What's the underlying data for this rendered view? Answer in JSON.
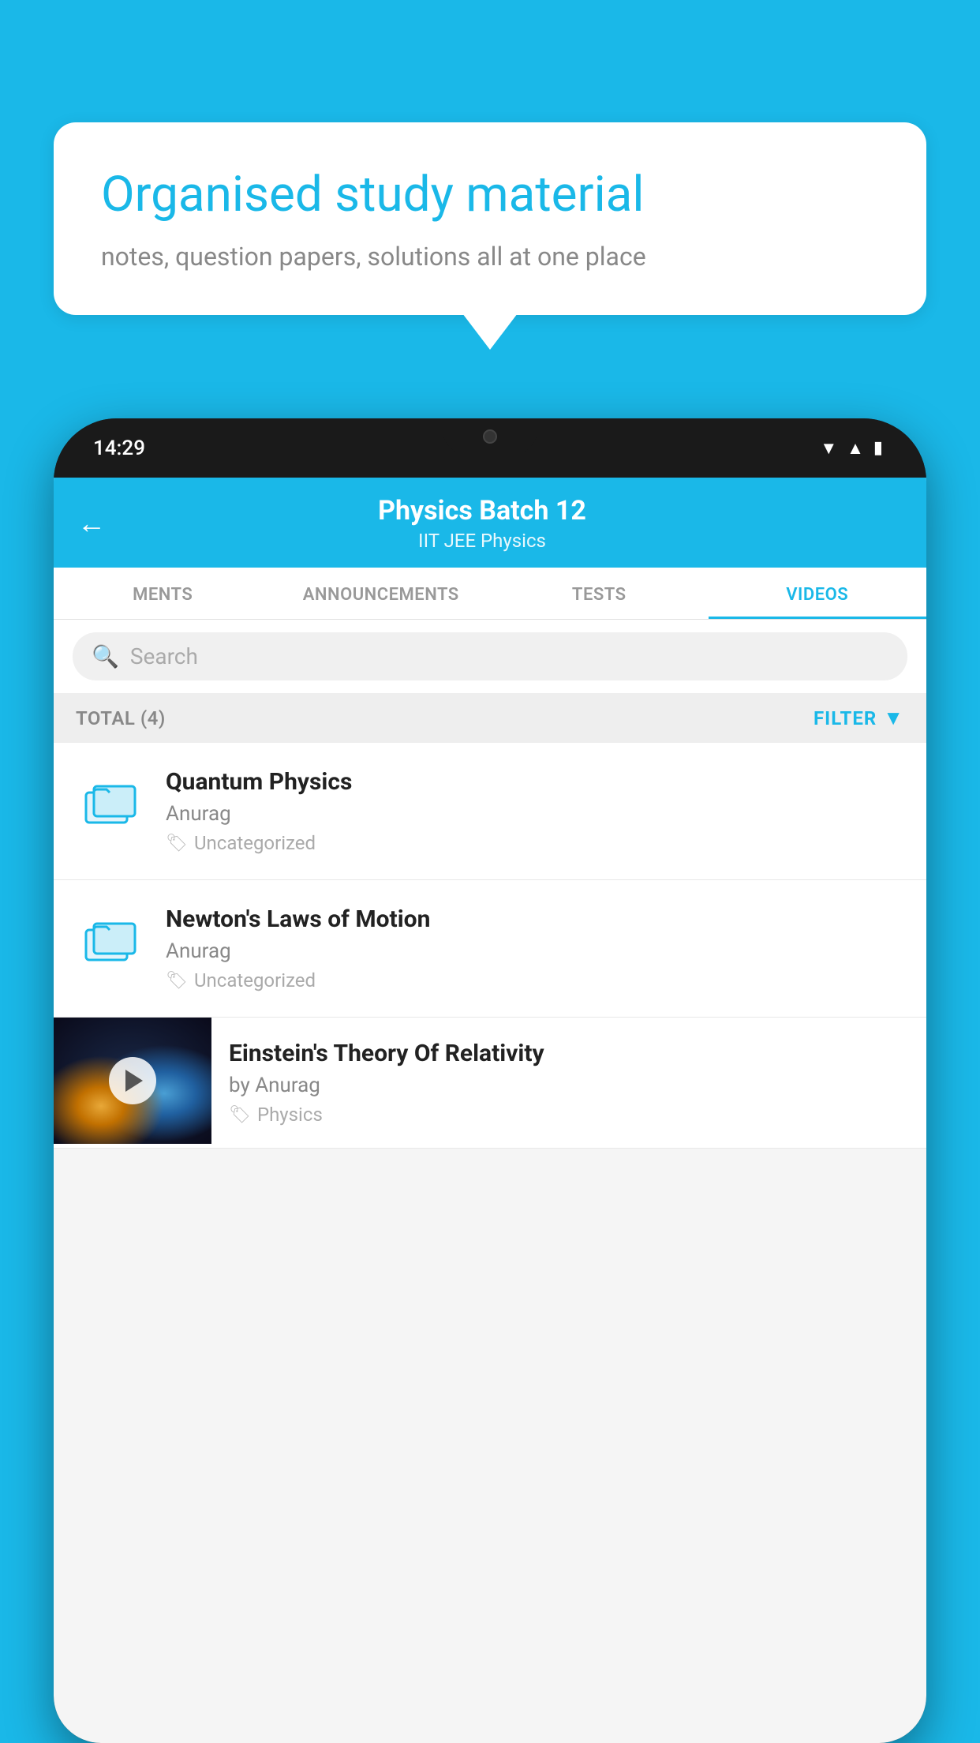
{
  "background_color": "#1ab8e8",
  "speech_bubble": {
    "title": "Organised study material",
    "subtitle": "notes, question papers, solutions all at one place"
  },
  "phone": {
    "status_bar": {
      "time": "14:29"
    },
    "header": {
      "title": "Physics Batch 12",
      "subtitle": "IIT JEE   Physics",
      "back_label": "←"
    },
    "tabs": [
      {
        "label": "MENTS",
        "active": false
      },
      {
        "label": "ANNOUNCEMENTS",
        "active": false
      },
      {
        "label": "TESTS",
        "active": false
      },
      {
        "label": "VIDEOS",
        "active": true
      }
    ],
    "search": {
      "placeholder": "Search"
    },
    "filter_bar": {
      "total_label": "TOTAL (4)",
      "filter_label": "FILTER"
    },
    "videos": [
      {
        "id": "quantum-physics",
        "title": "Quantum Physics",
        "author": "Anurag",
        "tag": "Uncategorized",
        "type": "folder"
      },
      {
        "id": "newtons-laws",
        "title": "Newton's Laws of Motion",
        "author": "Anurag",
        "tag": "Uncategorized",
        "type": "folder"
      },
      {
        "id": "einstein-relativity",
        "title": "Einstein's Theory Of Relativity",
        "author": "by Anurag",
        "tag": "Physics",
        "type": "video"
      }
    ]
  }
}
